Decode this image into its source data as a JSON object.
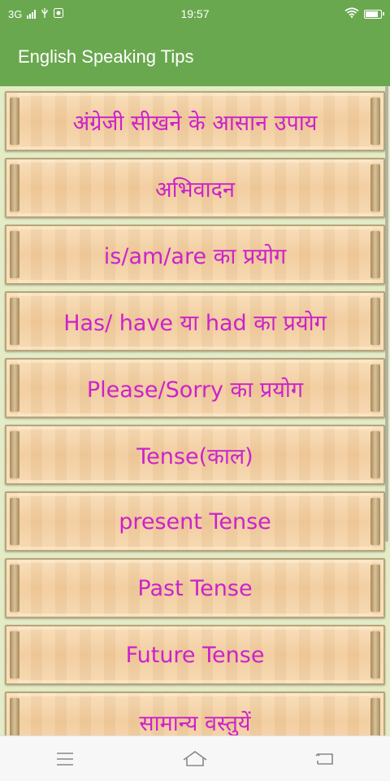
{
  "status_bar": {
    "network": "3G",
    "time": "19:57",
    "battery_level": 0.9
  },
  "app_bar": {
    "title": "English Speaking Tips"
  },
  "tips": [
    {
      "label": "अंग्रेजी सीखने के आसान उपाय"
    },
    {
      "label": "अभिवादन"
    },
    {
      "label": "is/am/are का प्रयोग"
    },
    {
      "label": "Has/ have या had का प्रयोग"
    },
    {
      "label": "Please/Sorry का प्रयोग"
    },
    {
      "label": "Tense(काल)"
    },
    {
      "label": "present Tense"
    },
    {
      "label": "Past Tense"
    },
    {
      "label": "Future Tense"
    },
    {
      "label": "सामान्य वस्तुयें"
    }
  ],
  "nav_bar": {
    "icons": [
      "menu-icon",
      "home-icon",
      "back-icon"
    ]
  },
  "colors": {
    "primary": "#6aa84f",
    "label": "#cc22cc",
    "background": "#e3ecc6"
  }
}
